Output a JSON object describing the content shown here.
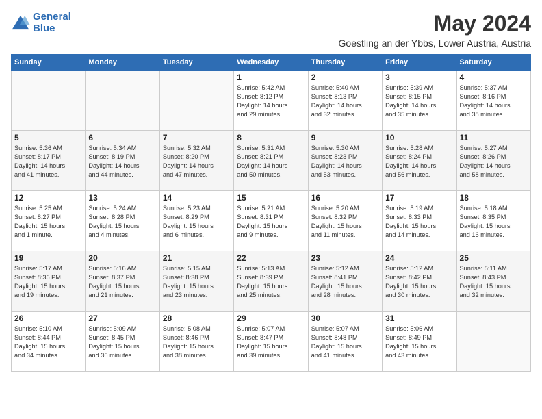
{
  "logo": {
    "line1": "General",
    "line2": "Blue"
  },
  "title": "May 2024",
  "location": "Goestling an der Ybbs, Lower Austria, Austria",
  "weekdays": [
    "Sunday",
    "Monday",
    "Tuesday",
    "Wednesday",
    "Thursday",
    "Friday",
    "Saturday"
  ],
  "weeks": [
    [
      {
        "day": "",
        "info": ""
      },
      {
        "day": "",
        "info": ""
      },
      {
        "day": "",
        "info": ""
      },
      {
        "day": "1",
        "info": "Sunrise: 5:42 AM\nSunset: 8:12 PM\nDaylight: 14 hours\nand 29 minutes."
      },
      {
        "day": "2",
        "info": "Sunrise: 5:40 AM\nSunset: 8:13 PM\nDaylight: 14 hours\nand 32 minutes."
      },
      {
        "day": "3",
        "info": "Sunrise: 5:39 AM\nSunset: 8:15 PM\nDaylight: 14 hours\nand 35 minutes."
      },
      {
        "day": "4",
        "info": "Sunrise: 5:37 AM\nSunset: 8:16 PM\nDaylight: 14 hours\nand 38 minutes."
      }
    ],
    [
      {
        "day": "5",
        "info": "Sunrise: 5:36 AM\nSunset: 8:17 PM\nDaylight: 14 hours\nand 41 minutes."
      },
      {
        "day": "6",
        "info": "Sunrise: 5:34 AM\nSunset: 8:19 PM\nDaylight: 14 hours\nand 44 minutes."
      },
      {
        "day": "7",
        "info": "Sunrise: 5:32 AM\nSunset: 8:20 PM\nDaylight: 14 hours\nand 47 minutes."
      },
      {
        "day": "8",
        "info": "Sunrise: 5:31 AM\nSunset: 8:21 PM\nDaylight: 14 hours\nand 50 minutes."
      },
      {
        "day": "9",
        "info": "Sunrise: 5:30 AM\nSunset: 8:23 PM\nDaylight: 14 hours\nand 53 minutes."
      },
      {
        "day": "10",
        "info": "Sunrise: 5:28 AM\nSunset: 8:24 PM\nDaylight: 14 hours\nand 56 minutes."
      },
      {
        "day": "11",
        "info": "Sunrise: 5:27 AM\nSunset: 8:26 PM\nDaylight: 14 hours\nand 58 minutes."
      }
    ],
    [
      {
        "day": "12",
        "info": "Sunrise: 5:25 AM\nSunset: 8:27 PM\nDaylight: 15 hours\nand 1 minute."
      },
      {
        "day": "13",
        "info": "Sunrise: 5:24 AM\nSunset: 8:28 PM\nDaylight: 15 hours\nand 4 minutes."
      },
      {
        "day": "14",
        "info": "Sunrise: 5:23 AM\nSunset: 8:29 PM\nDaylight: 15 hours\nand 6 minutes."
      },
      {
        "day": "15",
        "info": "Sunrise: 5:21 AM\nSunset: 8:31 PM\nDaylight: 15 hours\nand 9 minutes."
      },
      {
        "day": "16",
        "info": "Sunrise: 5:20 AM\nSunset: 8:32 PM\nDaylight: 15 hours\nand 11 minutes."
      },
      {
        "day": "17",
        "info": "Sunrise: 5:19 AM\nSunset: 8:33 PM\nDaylight: 15 hours\nand 14 minutes."
      },
      {
        "day": "18",
        "info": "Sunrise: 5:18 AM\nSunset: 8:35 PM\nDaylight: 15 hours\nand 16 minutes."
      }
    ],
    [
      {
        "day": "19",
        "info": "Sunrise: 5:17 AM\nSunset: 8:36 PM\nDaylight: 15 hours\nand 19 minutes."
      },
      {
        "day": "20",
        "info": "Sunrise: 5:16 AM\nSunset: 8:37 PM\nDaylight: 15 hours\nand 21 minutes."
      },
      {
        "day": "21",
        "info": "Sunrise: 5:15 AM\nSunset: 8:38 PM\nDaylight: 15 hours\nand 23 minutes."
      },
      {
        "day": "22",
        "info": "Sunrise: 5:13 AM\nSunset: 8:39 PM\nDaylight: 15 hours\nand 25 minutes."
      },
      {
        "day": "23",
        "info": "Sunrise: 5:12 AM\nSunset: 8:41 PM\nDaylight: 15 hours\nand 28 minutes."
      },
      {
        "day": "24",
        "info": "Sunrise: 5:12 AM\nSunset: 8:42 PM\nDaylight: 15 hours\nand 30 minutes."
      },
      {
        "day": "25",
        "info": "Sunrise: 5:11 AM\nSunset: 8:43 PM\nDaylight: 15 hours\nand 32 minutes."
      }
    ],
    [
      {
        "day": "26",
        "info": "Sunrise: 5:10 AM\nSunset: 8:44 PM\nDaylight: 15 hours\nand 34 minutes."
      },
      {
        "day": "27",
        "info": "Sunrise: 5:09 AM\nSunset: 8:45 PM\nDaylight: 15 hours\nand 36 minutes."
      },
      {
        "day": "28",
        "info": "Sunrise: 5:08 AM\nSunset: 8:46 PM\nDaylight: 15 hours\nand 38 minutes."
      },
      {
        "day": "29",
        "info": "Sunrise: 5:07 AM\nSunset: 8:47 PM\nDaylight: 15 hours\nand 39 minutes."
      },
      {
        "day": "30",
        "info": "Sunrise: 5:07 AM\nSunset: 8:48 PM\nDaylight: 15 hours\nand 41 minutes."
      },
      {
        "day": "31",
        "info": "Sunrise: 5:06 AM\nSunset: 8:49 PM\nDaylight: 15 hours\nand 43 minutes."
      },
      {
        "day": "",
        "info": ""
      }
    ]
  ]
}
